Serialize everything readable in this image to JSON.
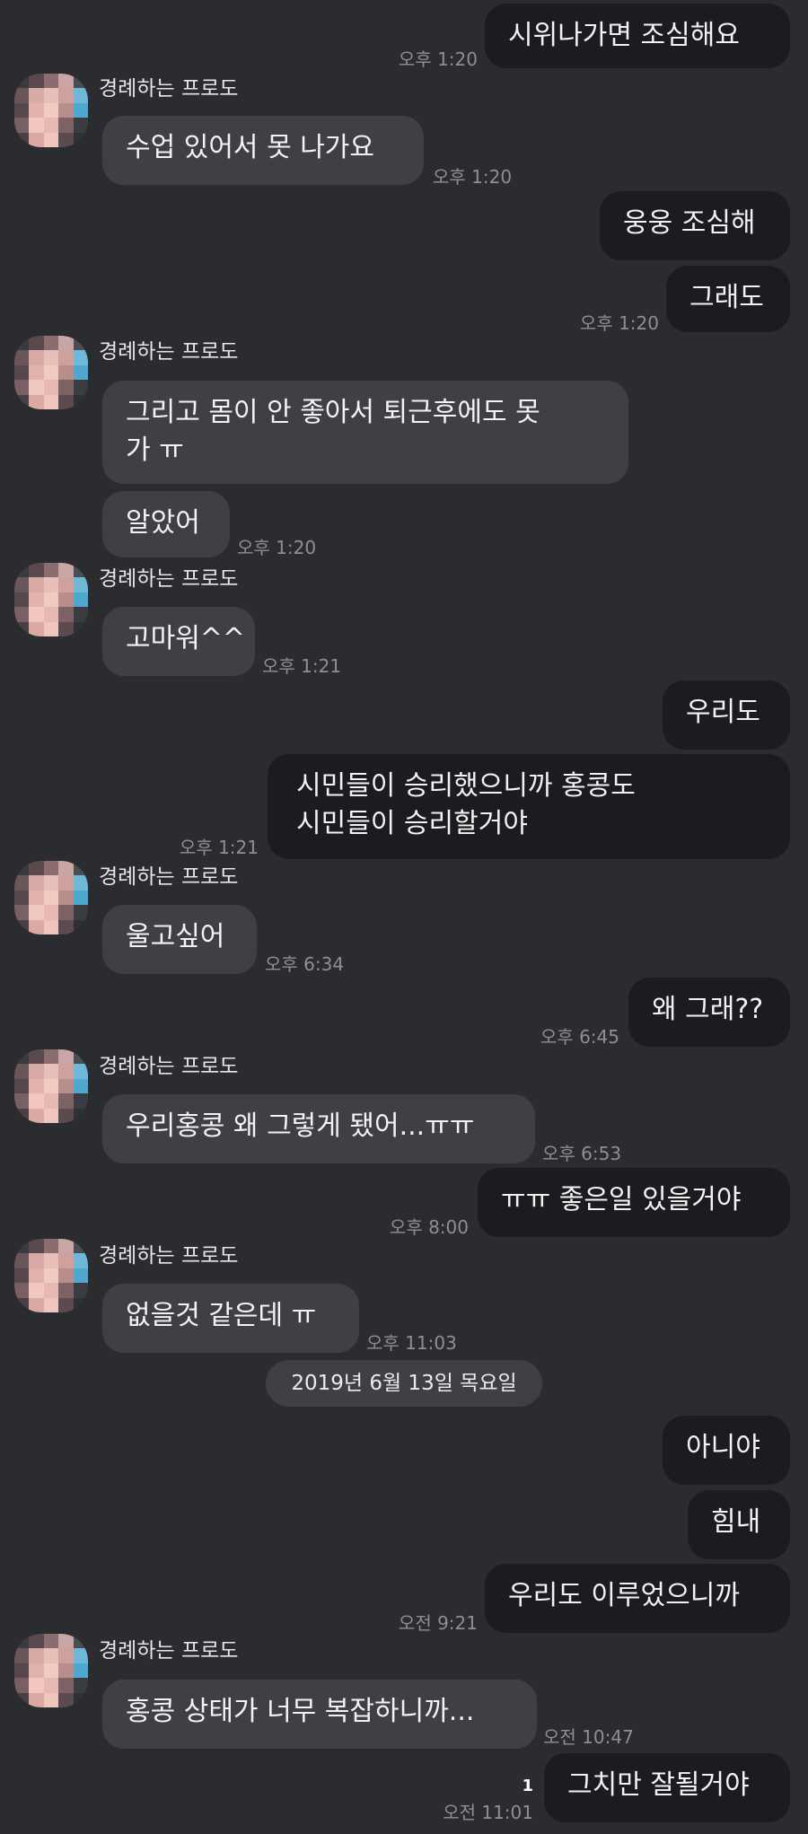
{
  "chat": {
    "sender_name": "경례하는 프로도",
    "date_divider": "2019년 6월 13일 목요일",
    "unread_count": "1",
    "messages": [
      {
        "text": "시위나가면 조심해요",
        "time": "오후 1:20"
      },
      {
        "text": "수업 있어서 못 나가요",
        "time": "오후 1:20"
      },
      {
        "text": "웅웅 조심해"
      },
      {
        "text": "그래도",
        "time": "오후 1:20"
      },
      {
        "lines": [
          "그리고 몸이 안 좋아서 퇴근후에도 못",
          "가 ㅠ"
        ]
      },
      {
        "text": "알았어",
        "time": "오후 1:20"
      },
      {
        "text": "고마워^^",
        "time": "오후 1:21"
      },
      {
        "text": "우리도"
      },
      {
        "lines": [
          "시민들이 승리했으니까 홍콩도",
          "시민들이 승리할거야"
        ],
        "time": "오후 1:21"
      },
      {
        "text": "울고싶어",
        "time": "오후 6:34"
      },
      {
        "text": "왜 그래??",
        "time": "오후 6:45"
      },
      {
        "text": "우리홍콩 왜 그렇게 됐어...ㅠㅠ",
        "time": "오후 6:53"
      },
      {
        "text": "ㅠㅠ 좋은일 있을거야",
        "time": "오후 8:00"
      },
      {
        "text": "없을것 같은데 ㅠ",
        "time": "오후 11:03"
      },
      {
        "text": "아니야"
      },
      {
        "text": "힘내"
      },
      {
        "text": "우리도 이루었으니까",
        "time": "오전 9:21"
      },
      {
        "text": "홍콩 상태가 너무 복잡하니까...",
        "time": "오전 10:47"
      },
      {
        "text": "그치만 잘될거야",
        "time": "오전 11:01"
      }
    ]
  },
  "colors": {
    "background": "#2a2c30",
    "outgoing_bubble": "#1b1c1f",
    "incoming_bubble": "#3e4046",
    "timestamp": "#8d8f94"
  }
}
